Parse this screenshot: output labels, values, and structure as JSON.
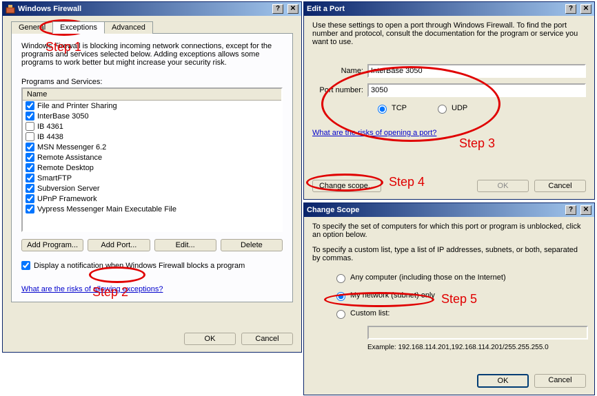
{
  "firewall": {
    "title": "Windows Firewall",
    "tabs": {
      "general": "General",
      "exceptions": "Exceptions",
      "advanced": "Advanced"
    },
    "desc": "Windows Firewall is blocking incoming network connections, except for the programs and services selected below. Adding exceptions allows some programs to work better but might increase your security risk.",
    "programsLabel": "Programs and Services:",
    "nameHeader": "Name",
    "items": [
      {
        "label": "File and Printer Sharing",
        "checked": true
      },
      {
        "label": "InterBase 3050",
        "checked": true
      },
      {
        "label": "IB 4361",
        "checked": false
      },
      {
        "label": "IB 4438",
        "checked": false
      },
      {
        "label": "MSN Messenger 6.2",
        "checked": true
      },
      {
        "label": "Remote Assistance",
        "checked": true
      },
      {
        "label": "Remote Desktop",
        "checked": true
      },
      {
        "label": "SmartFTP",
        "checked": true
      },
      {
        "label": "Subversion Server",
        "checked": true
      },
      {
        "label": "UPnP Framework",
        "checked": true
      },
      {
        "label": "Vypress Messenger Main Executable File",
        "checked": true
      }
    ],
    "buttons": {
      "addProgram": "Add Program...",
      "addPort": "Add Port...",
      "edit": "Edit...",
      "delete": "Delete"
    },
    "notify": "Display a notification when Windows Firewall blocks a program",
    "risksLink": "What are the risks of allowing exceptions?",
    "ok": "OK",
    "cancel": "Cancel"
  },
  "editPort": {
    "title": "Edit a Port",
    "desc": "Use these settings to open a port through Windows Firewall. To find the port number and protocol, consult the documentation for the program or service you want to use.",
    "nameLabel": "Name:",
    "nameValue": "InterBase 3050",
    "portLabel": "Port number:",
    "portValue": "3050",
    "tcp": "TCP",
    "udp": "UDP",
    "risksLink": "What are the risks of opening a port?",
    "changeScope": "Change scope...",
    "ok": "OK",
    "cancel": "Cancel"
  },
  "scope": {
    "title": "Change Scope",
    "desc1": "To specify the set of computers for which this port or program is unblocked, click an option below.",
    "desc2": "To specify a custom list, type a list of IP addresses, subnets, or both, separated by commas.",
    "opt1": "Any computer (including those on the Internet)",
    "opt2": "My network (subnet) only",
    "opt3": "Custom list:",
    "example": "Example: 192.168.114.201,192.168.114.201/255.255.255.0",
    "ok": "OK",
    "cancel": "Cancel"
  },
  "annotations": {
    "step1": "Step 1",
    "step2": "Step 2",
    "step3": "Step 3",
    "step4": "Step 4",
    "step5": "Step 5"
  }
}
